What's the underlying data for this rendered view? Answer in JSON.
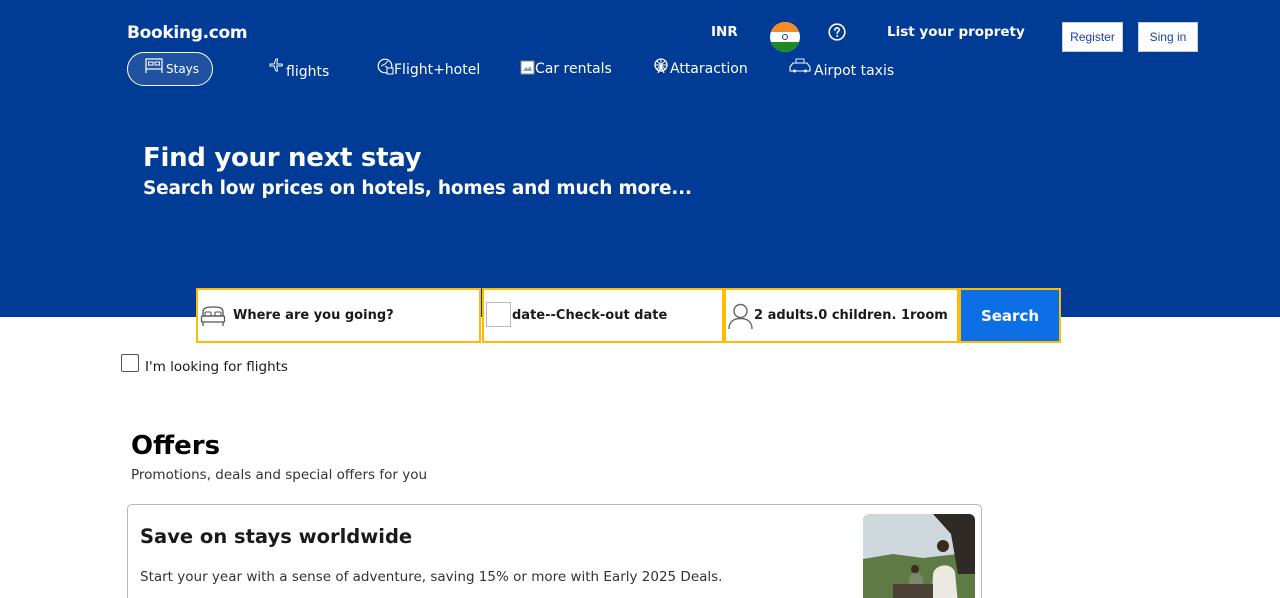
{
  "header": {
    "logo": "Booking.com",
    "currency": "INR",
    "list_property": "List your proprety",
    "register": "Register",
    "sign_in": "Sing in"
  },
  "nav": {
    "items": [
      {
        "label": "Stays",
        "icon": "bed-icon",
        "active": true
      },
      {
        "label": "flights",
        "icon": "plane-icon"
      },
      {
        "label": "Flight+hotel",
        "icon": "flight-hotel-icon"
      },
      {
        "label": "Car rentals",
        "icon": "broken-image-icon"
      },
      {
        "label": "Attaraction",
        "icon": "ferris-wheel-icon"
      },
      {
        "label": "Airpot taxis",
        "icon": "taxi-icon"
      }
    ]
  },
  "hero": {
    "title": "Find your next stay",
    "subtitle": "Search low prices on hotels, homes and much more..."
  },
  "search": {
    "destination": "Where are you going?",
    "dates": "date--Check-out date",
    "guests": "2 adults.0 children. 1room",
    "button": "Search",
    "flights_checkbox": "I'm looking for flights"
  },
  "offers": {
    "title": "Offers",
    "subtitle": "Promotions, deals and special offers for you",
    "card": {
      "title": "Save on stays worldwide",
      "description": "Start your year with a sense of adventure, saving 15% or more with Early 2025 Deals."
    }
  },
  "colors": {
    "hero_bg": "#003b95",
    "accent_border": "#febb02",
    "search_button": "#0d6fe6"
  }
}
